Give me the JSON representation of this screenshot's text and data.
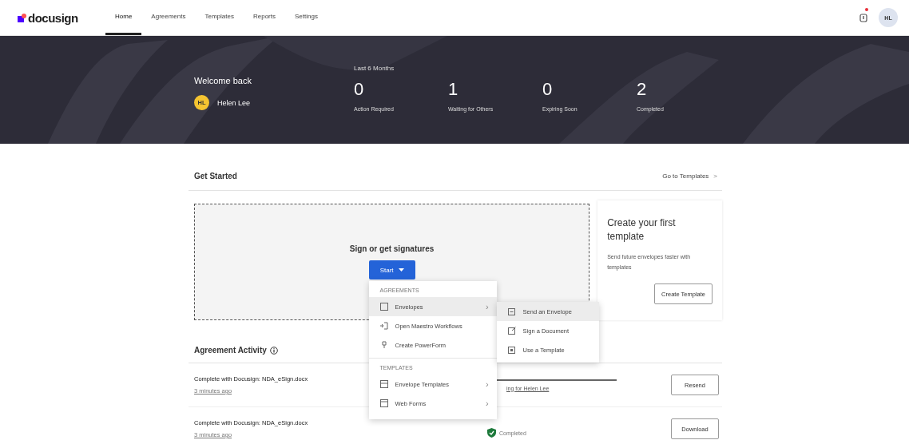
{
  "nav": {
    "logo": "docusign",
    "tabs": [
      {
        "label": "Home",
        "selected": true
      },
      {
        "label": "Agreements",
        "selected": false
      },
      {
        "label": "Templates",
        "selected": false
      },
      {
        "label": "Reports",
        "selected": false
      },
      {
        "label": "Settings",
        "selected": false
      }
    ],
    "notification": true,
    "avatar": "HL"
  },
  "banner": {
    "greeting": "Welcome back",
    "user_initials": "HL",
    "user_name": "Helen Lee",
    "period": "Last 6 Months",
    "stats": [
      {
        "value": "0",
        "label": "Action Required"
      },
      {
        "value": "1",
        "label": "Waiting for Others"
      },
      {
        "value": "0",
        "label": "Expiring Soon"
      },
      {
        "value": "2",
        "label": "Completed"
      }
    ]
  },
  "get_started": {
    "title": "Get Started",
    "link": "Go to Templates",
    "link_icon": ">",
    "prompt": "Sign or get signatures",
    "start_button": "Start",
    "template_card": {
      "title": "Create your first template",
      "text": "Send future envelopes faster with templates",
      "button": "Create Template"
    }
  },
  "start_menu": {
    "sections": [
      {
        "heading": "AGREEMENTS",
        "items": [
          {
            "label": "Envelopes",
            "kind": "envelope",
            "chevron": "›",
            "selected": true
          },
          {
            "label": "Open Maestro Workflows",
            "kind": "workflow",
            "selected": false
          },
          {
            "label": "Create PowerForm",
            "kind": "form",
            "selected": false
          }
        ]
      },
      {
        "heading": "TEMPLATES",
        "items": [
          {
            "label": "Envelope Templates",
            "kind": "template",
            "chevron": "›",
            "selected": false
          },
          {
            "label": "Web Forms",
            "kind": "web",
            "chevron": "›",
            "selected": false
          }
        ]
      }
    ],
    "submenu": [
      {
        "label": "Send an Envelope",
        "kind": "send",
        "selected": true
      },
      {
        "label": "Sign a Document",
        "kind": "sign",
        "selected": false
      },
      {
        "label": "Use a Template",
        "kind": "template",
        "selected": false
      }
    ]
  },
  "activity": {
    "title": "Agreement Activity",
    "rows": [
      {
        "name": "Complete with Docusign: NDA_eSign.docx",
        "time": "3 minutes ago",
        "kind": "waiting",
        "status": "ing for Helen Lee",
        "level": 1,
        "action": "Resend"
      },
      {
        "name": "Complete with Docusign: NDA_eSign.docx",
        "time": "3 minutes ago",
        "kind": "completed",
        "status": "Completed",
        "action": "Download"
      }
    ]
  }
}
